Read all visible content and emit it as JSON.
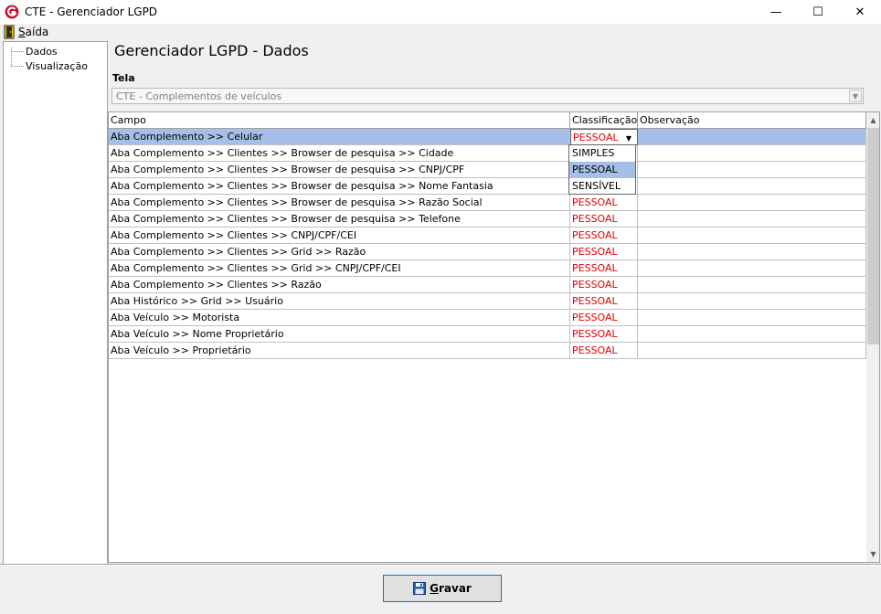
{
  "window": {
    "title": "CTE - Gerenciador LGPD",
    "minimize_glyph": "—",
    "maximize_glyph": "☐",
    "close_glyph": "✕"
  },
  "menu": {
    "exit_underlined": "S",
    "exit_rest": "aída"
  },
  "tree": {
    "items": [
      {
        "label": "Dados"
      },
      {
        "label": "Visualização"
      }
    ]
  },
  "main": {
    "heading": "Gerenciador LGPD - Dados",
    "tela_label": "Tela",
    "tela_value": "CTE - Complementos de veículos"
  },
  "grid": {
    "columns": [
      "Campo",
      "Classificação",
      "Observação"
    ],
    "rows": [
      {
        "campo": "Aba Complemento >> Celular",
        "classificacao": "PESSOAL",
        "observacao": ""
      },
      {
        "campo": "Aba Complemento >> Clientes >> Browser de pesquisa >> Cidade",
        "classificacao": "",
        "observacao": ""
      },
      {
        "campo": "Aba Complemento >> Clientes >> Browser de pesquisa >> CNPJ/CPF",
        "classificacao": "",
        "observacao": ""
      },
      {
        "campo": "Aba Complemento >> Clientes >> Browser de pesquisa >> Nome Fantasia",
        "classificacao": "",
        "observacao": ""
      },
      {
        "campo": "Aba Complemento >> Clientes >> Browser de pesquisa >> Razão Social",
        "classificacao": "PESSOAL",
        "observacao": ""
      },
      {
        "campo": "Aba Complemento >> Clientes >> Browser de pesquisa >> Telefone",
        "classificacao": "PESSOAL",
        "observacao": ""
      },
      {
        "campo": "Aba Complemento >> Clientes >> CNPJ/CPF/CEI",
        "classificacao": "PESSOAL",
        "observacao": ""
      },
      {
        "campo": "Aba Complemento >> Clientes >> Grid >>  Razão",
        "classificacao": "PESSOAL",
        "observacao": ""
      },
      {
        "campo": "Aba Complemento >> Clientes >> Grid >> CNPJ/CPF/CEI",
        "classificacao": "PESSOAL",
        "observacao": ""
      },
      {
        "campo": "Aba Complemento >> Clientes >> Razão",
        "classificacao": "PESSOAL",
        "observacao": ""
      },
      {
        "campo": "Aba Histórico >> Grid >> Usuário",
        "classificacao": "PESSOAL",
        "observacao": ""
      },
      {
        "campo": "Aba Veículo >> Motorista",
        "classificacao": "PESSOAL",
        "observacao": ""
      },
      {
        "campo": "Aba Veículo >> Nome Proprietário",
        "classificacao": "PESSOAL",
        "observacao": ""
      },
      {
        "campo": "Aba Veículo >> Proprietário",
        "classificacao": "PESSOAL",
        "observacao": ""
      }
    ],
    "dropdown_options": [
      "SIMPLES",
      "PESSOAL",
      "SENSÍVEL"
    ],
    "dropdown_highlighted": "PESSOAL",
    "classification_color": "#e00000",
    "selection_color": "#a6bfe8"
  },
  "footer": {
    "save_underlined": "G",
    "save_rest": "ravar"
  }
}
